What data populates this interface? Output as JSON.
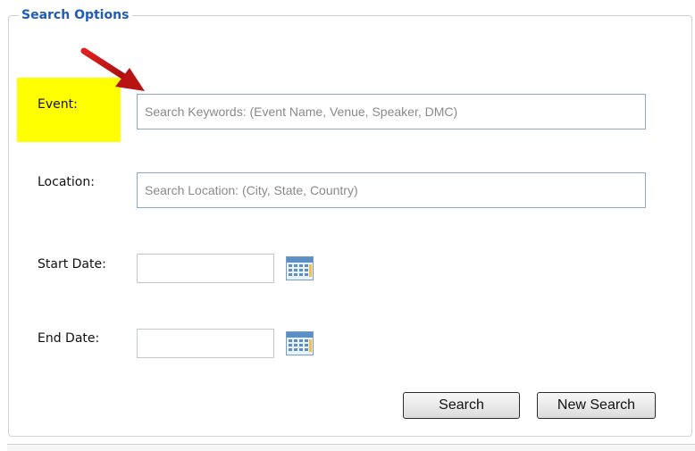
{
  "panel": {
    "legend": "Search Options"
  },
  "fields": {
    "event": {
      "label": "Event:",
      "placeholder": "Search Keywords:  (Event Name, Venue, Speaker, DMC)"
    },
    "location": {
      "label": "Location:",
      "placeholder": "Search Location:  (City, State, Country)"
    },
    "start_date": {
      "label": "Start Date:",
      "value": ""
    },
    "end_date": {
      "label": "End Date:",
      "value": ""
    }
  },
  "buttons": {
    "search": "Search",
    "new_search": "New Search"
  },
  "icons": {
    "calendar": "calendar-icon",
    "annotation": "red-arrow-icon"
  },
  "colors": {
    "legend": "#1f5bbd",
    "highlight": "#ffff00",
    "arrow": "#c01515",
    "input_border": "#8fa8c8"
  }
}
